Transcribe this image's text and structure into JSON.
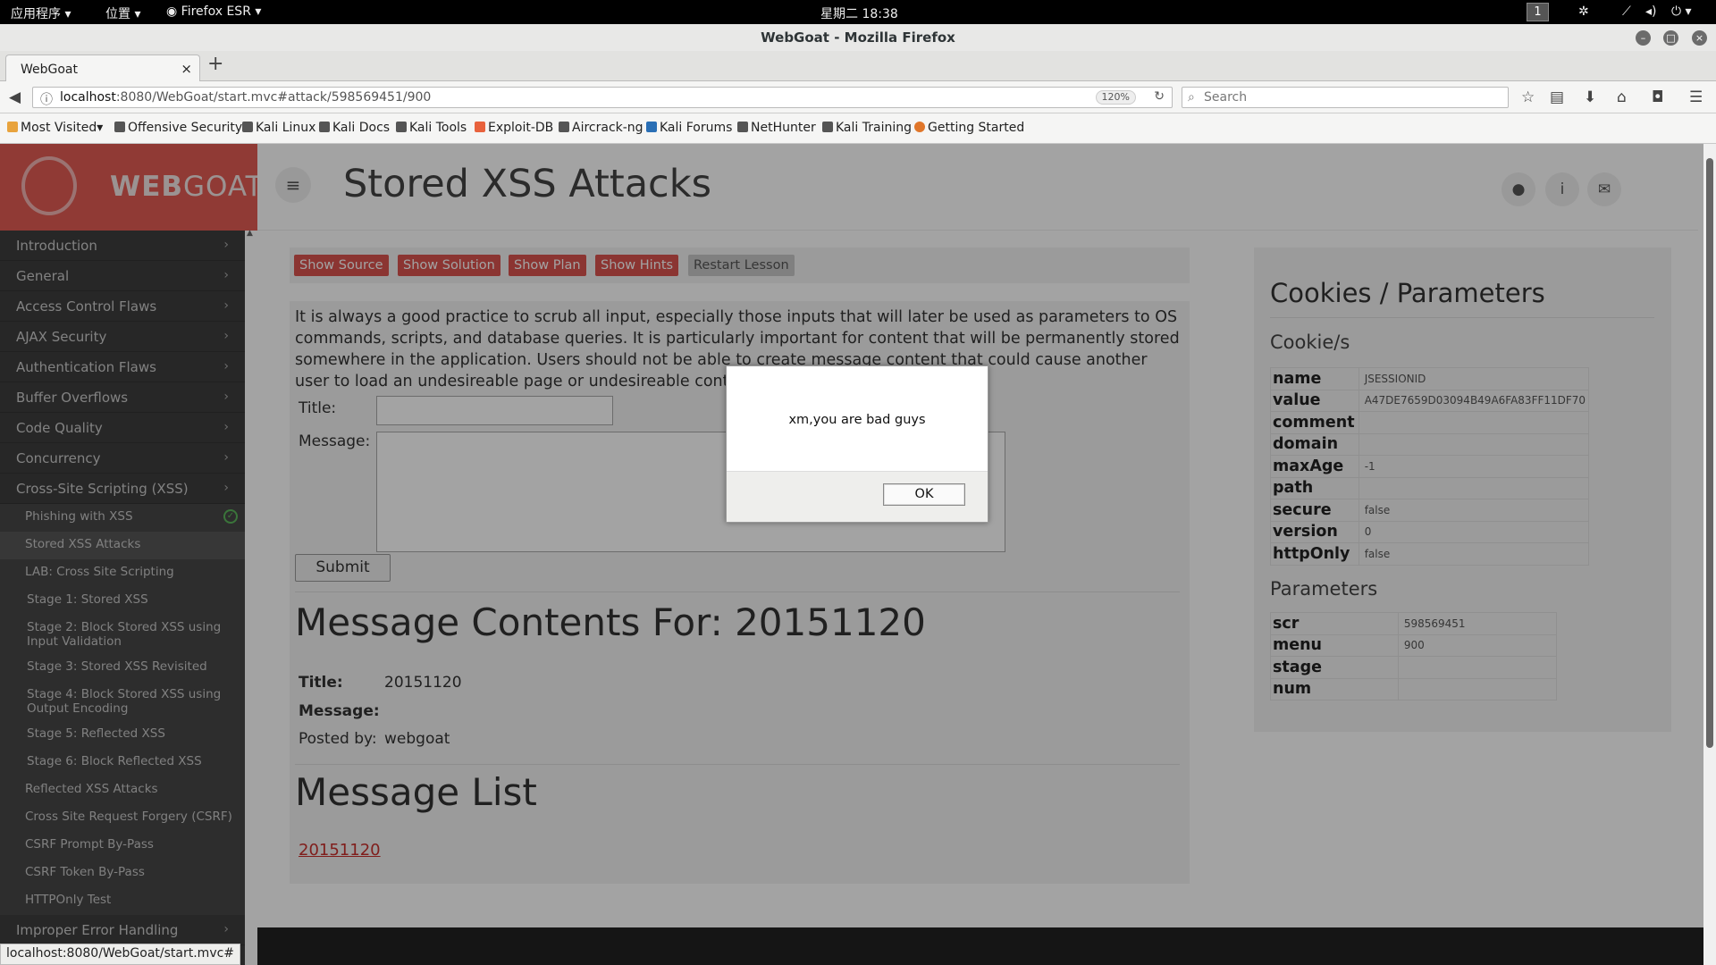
{
  "system_bar": {
    "apps": "应用程序 ▾",
    "places": "位置 ▾",
    "app": "Firefox ESR ▾",
    "clock": "星期二 18:38",
    "workspace": "1"
  },
  "window": {
    "title": "WebGoat - Mozilla Firefox"
  },
  "browser": {
    "tab_title": "WebGoat",
    "tab_close": "×",
    "new_tab": "+",
    "url_host": "localhost",
    "url_rest": ":8080/WebGoat/start.mvc#attack/598569451/900",
    "zoom": "120%",
    "search_placeholder": "Search",
    "bookmarks": [
      "Most Visited▾",
      "Offensive Security",
      "Kali Linux",
      "Kali Docs",
      "Kali Tools",
      "Exploit-DB",
      "Aircrack-ng",
      "Kali Forums",
      "NetHunter",
      "Kali Training",
      "Getting Started"
    ]
  },
  "app": {
    "logo_a": "WEB",
    "logo_b": "GOAT",
    "page_title": "Stored XSS Attacks",
    "sidebar": {
      "categories_top": [
        "Introduction",
        "General",
        "Access Control Flaws",
        "AJAX Security",
        "Authentication Flaws",
        "Buffer Overflows",
        "Code Quality",
        "Concurrency",
        "Cross-Site Scripting (XSS)"
      ],
      "sub_items": [
        "Phishing with XSS",
        "Stored XSS Attacks",
        "LAB: Cross Site Scripting",
        "Stage 1: Stored XSS",
        "Stage 2: Block Stored XSS using Input Validation",
        "Stage 3: Stored XSS Revisited",
        "Stage 4: Block Stored XSS using Output Encoding",
        "Stage 5: Reflected XSS",
        "Stage 6: Block Reflected XSS",
        "Reflected XSS Attacks",
        "Cross Site Request Forgery (CSRF)",
        "CSRF Prompt By-Pass",
        "CSRF Token By-Pass",
        "HTTPOnly Test"
      ],
      "categories_bottom": [
        "Improper Error Handling"
      ]
    },
    "lesson_buttons": [
      "Show Source",
      "Show Solution",
      "Show Plan",
      "Show Hints",
      "Restart Lesson"
    ],
    "intro": "It is always a good practice to scrub all input, especially those inputs that will later be used as parameters to OS commands, scripts, and database queries. It is particularly important for content that will be permanently stored somewhere in the application. Users should not be able to create message content that could cause another user to load an undesireable page or undesireable content when",
    "form": {
      "title_label": "Title:",
      "message_label": "Message:",
      "submit": "Submit"
    },
    "contents": {
      "heading": "Message Contents For: 20151120",
      "title_label": "Title:",
      "title_value": "20151120",
      "message_label": "Message:",
      "posted_label": "Posted by:",
      "posted_value": "webgoat"
    },
    "list": {
      "heading": "Message List",
      "link": "20151120"
    },
    "cookies": {
      "heading": "Cookies / Parameters",
      "cookie_heading": "Cookie/s",
      "rows": [
        {
          "k": "name",
          "v": "JSESSIONID"
        },
        {
          "k": "value",
          "v": "A47DE7659D03094B49A6FA83FF11DF70"
        },
        {
          "k": "comment",
          "v": ""
        },
        {
          "k": "domain",
          "v": ""
        },
        {
          "k": "maxAge",
          "v": "-1"
        },
        {
          "k": "path",
          "v": ""
        },
        {
          "k": "secure",
          "v": "false"
        },
        {
          "k": "version",
          "v": "0"
        },
        {
          "k": "httpOnly",
          "v": "false"
        }
      ],
      "param_heading": "Parameters",
      "params": [
        {
          "k": "scr",
          "v": "598569451"
        },
        {
          "k": "menu",
          "v": "900"
        },
        {
          "k": "stage",
          "v": ""
        },
        {
          "k": "num",
          "v": ""
        }
      ]
    }
  },
  "alert": {
    "message": "xm,you are bad guys",
    "ok": "OK"
  },
  "status_url": "localhost:8080/WebGoat/start.mvc#"
}
